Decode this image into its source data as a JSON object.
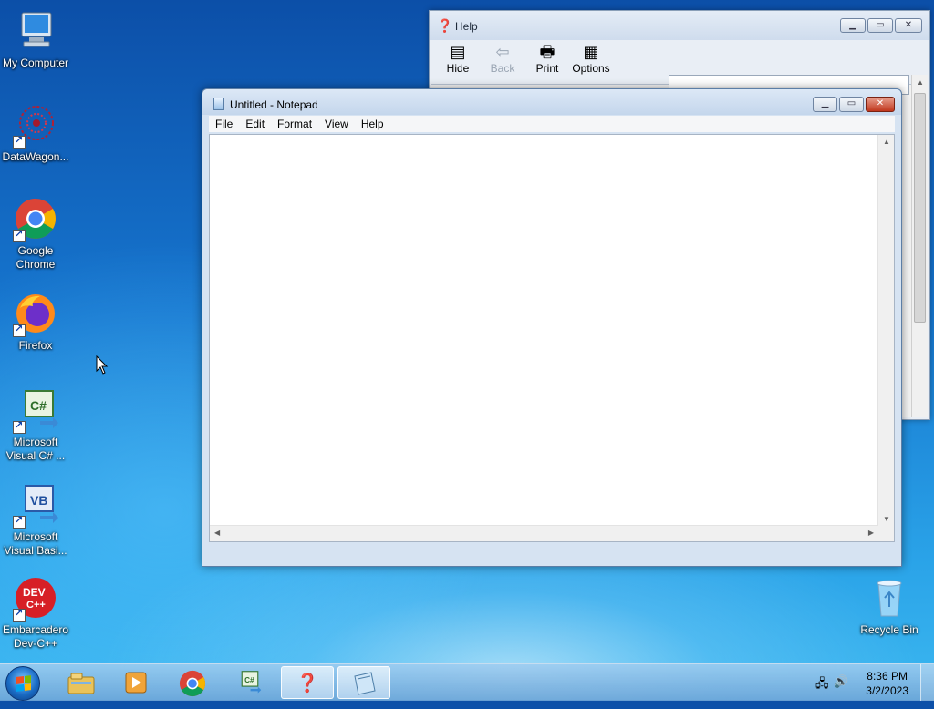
{
  "desktop": {
    "icons": [
      {
        "label": "My Computer",
        "icon": "computer-icon"
      },
      {
        "label": "DataWagon...",
        "icon": "datawagon-icon"
      },
      {
        "label": "Google Chrome",
        "icon": "chrome-icon"
      },
      {
        "label": "Firefox",
        "icon": "firefox-icon"
      },
      {
        "label": "Microsoft Visual C# ...",
        "icon": "visual-csharp-icon"
      },
      {
        "label": "Microsoft Visual Basi...",
        "icon": "visual-basic-icon"
      },
      {
        "label": "Embarcadero Dev-C++",
        "icon": "devcpp-icon"
      },
      {
        "label": "Recycle Bin",
        "icon": "recycle-bin-icon"
      }
    ]
  },
  "help_window": {
    "title": "Help",
    "toolbar": {
      "hide": "Hide",
      "back": "Back",
      "print": "Print",
      "options": "Options"
    }
  },
  "notepad": {
    "title": "Untitled - Notepad",
    "menu": [
      "File",
      "Edit",
      "Format",
      "View",
      "Help"
    ],
    "content": ""
  },
  "taskbar": {
    "clock_time": "8:36 PM",
    "clock_date": "3/2/2023",
    "pinned": [
      "explorer-icon",
      "media-player-icon",
      "chrome-icon",
      "visual-csharp-icon",
      "help-icon",
      "notepad-icon"
    ]
  },
  "colors": {
    "accent": "#1676cf",
    "close_red": "#c0361d"
  }
}
